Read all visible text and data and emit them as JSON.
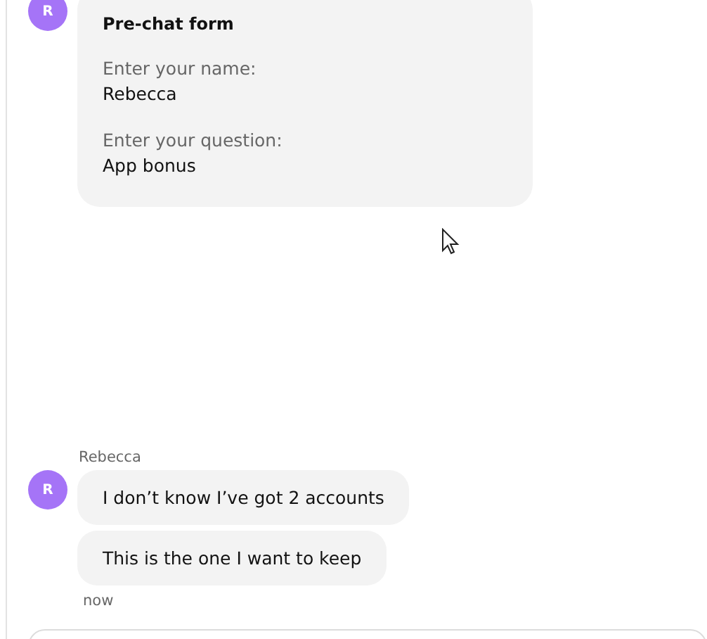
{
  "messages": [
    {
      "kind": "form",
      "author_initial": "R",
      "title": "Pre-chat form",
      "fields": [
        {
          "label": "Enter your name:",
          "value": "Rebecca"
        },
        {
          "label": "Enter your question:",
          "value": "App bonus"
        }
      ]
    },
    {
      "kind": "bubbles",
      "author_name": "Rebecca",
      "author_initial": "R",
      "texts": [
        "I don’t know I’ve got 2 accounts",
        "This is the one I want to keep"
      ],
      "time": "now"
    }
  ]
}
